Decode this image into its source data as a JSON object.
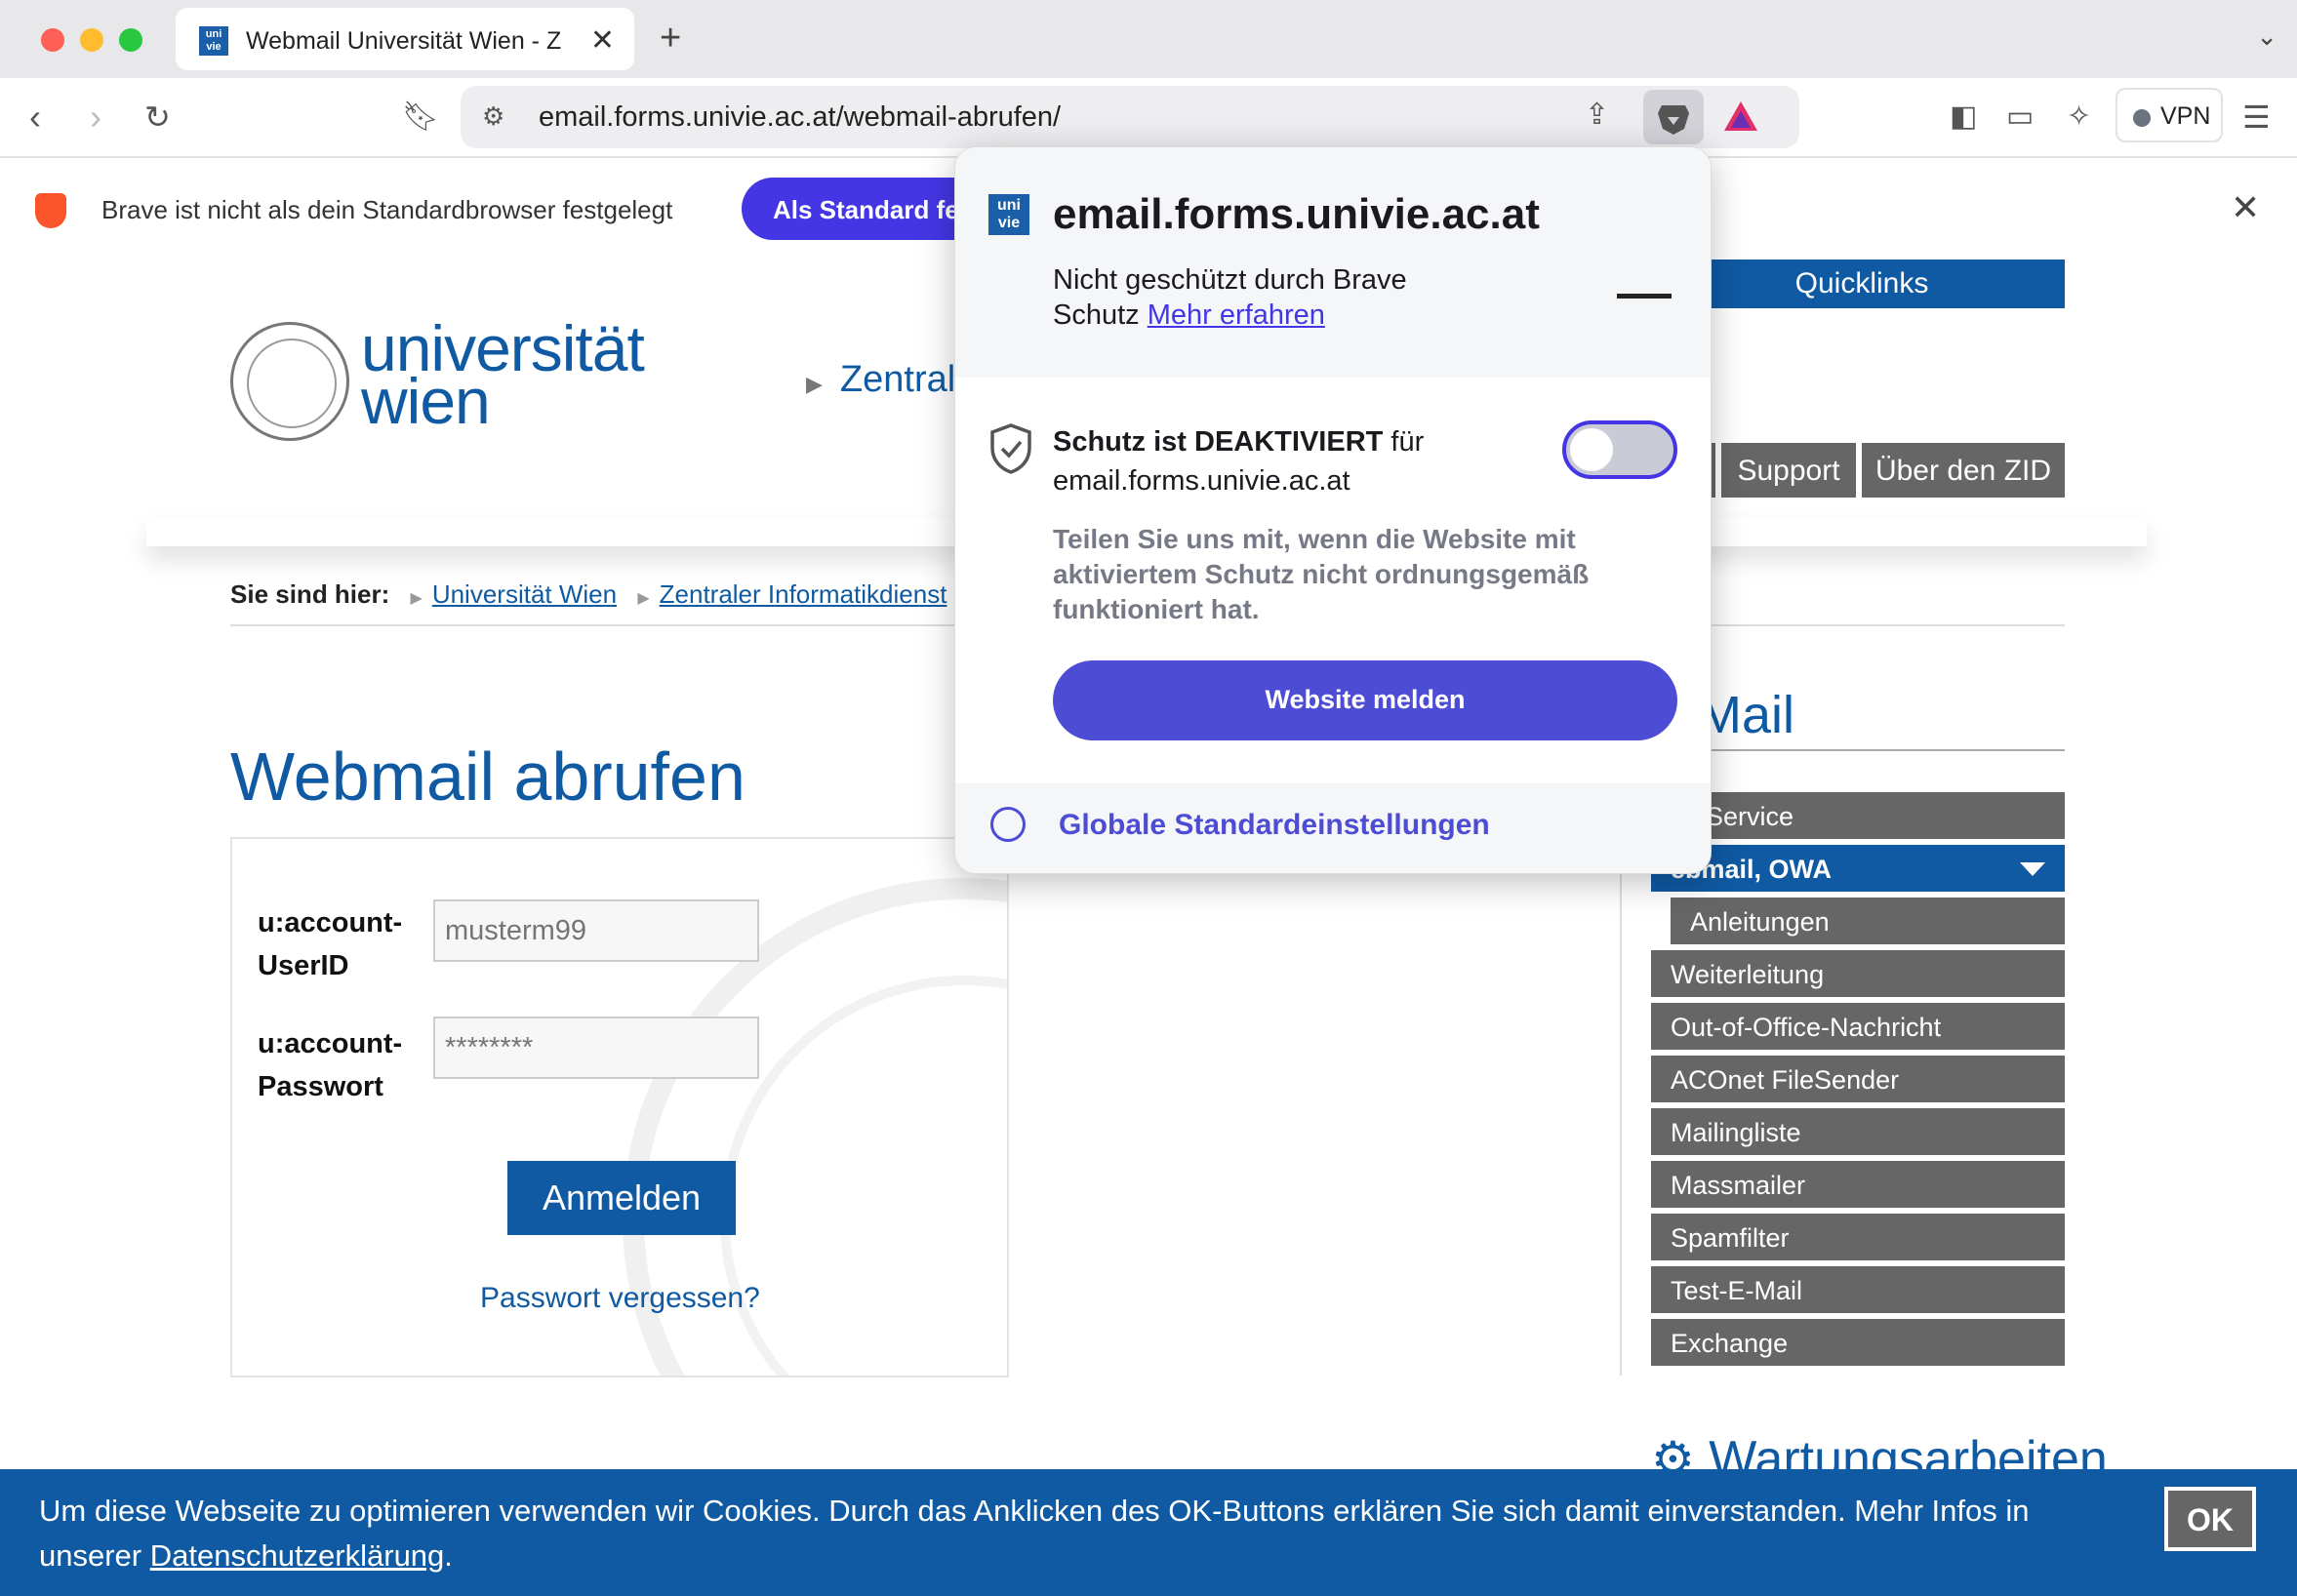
{
  "browser": {
    "tab_title": "Webmail Universität Wien - Z",
    "tab_favicon": "uni vie",
    "url": "email.forms.univie.ac.at/webmail-abrufen/",
    "vpn_label": "VPN"
  },
  "notification": {
    "message": "Brave ist nicht als dein Standardbrowser festgelegt",
    "button": "Als Standard fe"
  },
  "site": {
    "logo_line1": "universität",
    "logo_line2": "wien",
    "zentral": "Zentral",
    "quicklinks": "Quicklinks",
    "nav": [
      "Support",
      "Über den ZID"
    ],
    "breadcrumb_label": "Sie sind hier:",
    "breadcrumb": [
      "Universität Wien",
      "Zentraler Informatikdienst"
    ],
    "page_title": "Webmail abrufen",
    "login": {
      "user_label": "u:account-UserID",
      "user_placeholder": "musterm99",
      "pass_label": "u:account-Passwort",
      "pass_placeholder": "********",
      "submit": "Anmelden",
      "forgot": "Passwort vergessen?"
    },
    "sidebar_title": "Mail",
    "sidebar": [
      "ail-Service",
      "ebmail, OWA",
      "Anleitungen",
      "Weiterleitung",
      "Out-of-Office-Nachricht",
      "ACOnet FileSender",
      "Mailingliste",
      "Massmailer",
      "Spamfilter",
      "Test-E-Mail",
      "Exchange"
    ],
    "wartung": "Wartungsarbeiten"
  },
  "cookie": {
    "text": "Um diese Webseite zu optimieren verwenden wir Cookies. Durch das Anklicken des OK-Buttons erklären Sie sich damit einverstanden. Mehr Infos in unserer ",
    "link": "Datenschutzerklärung",
    "ok": "OK"
  },
  "popup": {
    "favicon": "uni vie",
    "domain": "email.forms.univie.ac.at",
    "status": "Nicht geschützt durch Brave Schutz",
    "learn_more": "Mehr erfahren",
    "protection_bold": "Schutz ist DEAKTIVIERT",
    "protection_rest": " für email.forms.univie.ac.at",
    "info": "Teilen Sie uns mit, wenn die Website mit aktiviertem Schutz nicht ordnungsgemäß funktioniert hat.",
    "report_button": "Website melden",
    "global_settings": "Globale Standardeinstellungen"
  },
  "colors": {
    "brand_blue": "#0f5aa3",
    "brave_purple": "#4436e4",
    "nav_grey": "#666666"
  }
}
